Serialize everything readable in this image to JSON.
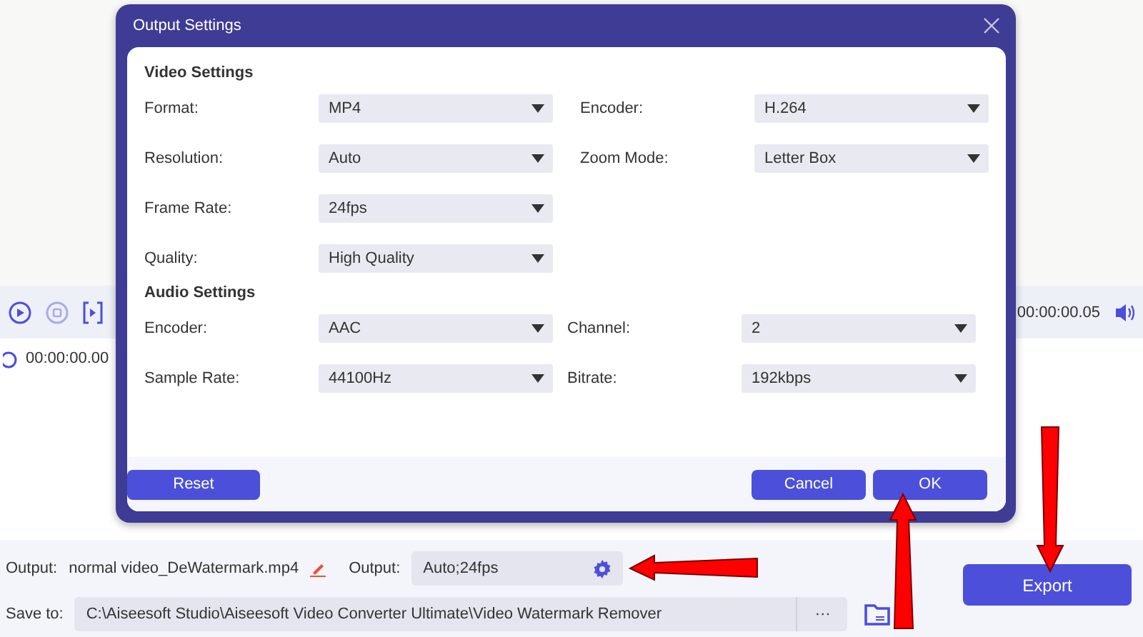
{
  "player": {
    "current_time": "00:00:00.00",
    "end_time": "00:00:00.05"
  },
  "output": {
    "label": "Output:",
    "file_name": "normal video_DeWatermark.mp4",
    "settings_label": "Output:",
    "settings_value": "Auto;24fps"
  },
  "save": {
    "label": "Save to:",
    "path": "C:\\Aiseesoft Studio\\Aiseesoft Video Converter Ultimate\\Video Watermark Remover",
    "browse": "···"
  },
  "export_button": "Export",
  "dialog": {
    "title": "Output Settings",
    "sections": [
      {
        "title": "Video Settings",
        "kind": "video",
        "rows": [
          [
            {
              "label": "Format:",
              "value": "MP4"
            },
            {
              "label": "Encoder:",
              "value": "H.264"
            }
          ],
          [
            {
              "label": "Resolution:",
              "value": "Auto"
            },
            {
              "label": "Zoom Mode:",
              "value": "Letter Box"
            }
          ],
          [
            {
              "label": "Frame Rate:",
              "value": "24fps"
            }
          ],
          [
            {
              "label": "Quality:",
              "value": "High Quality"
            }
          ]
        ]
      },
      {
        "title": "Audio Settings",
        "kind": "audio",
        "rows": [
          [
            {
              "label": "Encoder:",
              "value": "AAC"
            },
            {
              "label": "Channel:",
              "value": "2"
            }
          ],
          [
            {
              "label": "Sample Rate:",
              "value": "44100Hz"
            },
            {
              "label": "Bitrate:",
              "value": "192kbps"
            }
          ]
        ]
      }
    ],
    "reset_button": "Reset",
    "buttons": [
      "Cancel",
      "OK"
    ]
  }
}
